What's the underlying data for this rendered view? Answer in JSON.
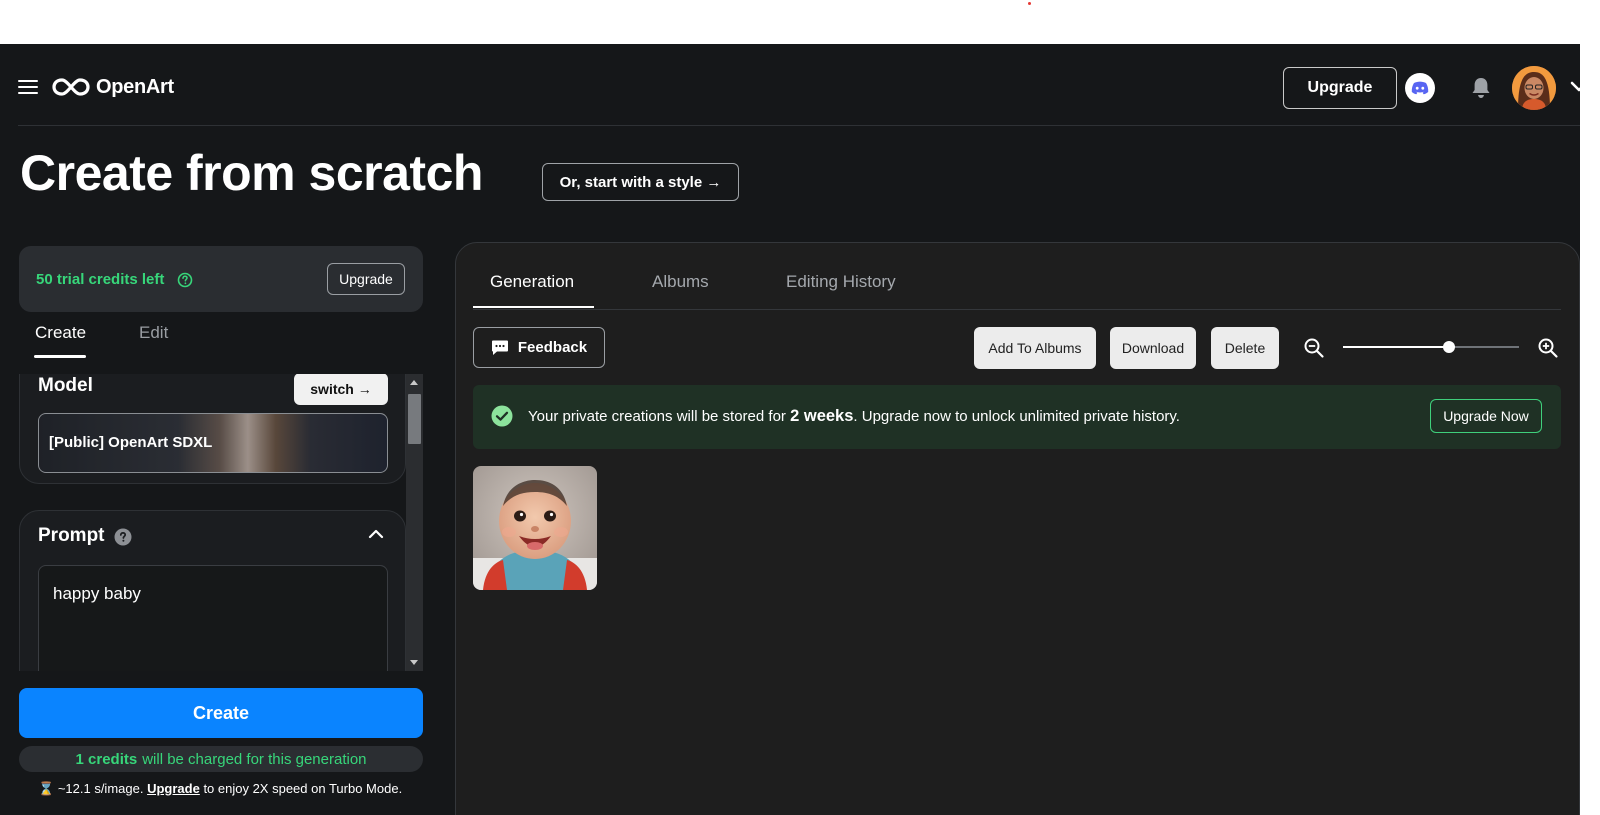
{
  "app": {
    "brand": "OpenArt",
    "upgrade_label": "Upgrade",
    "icons": {
      "menu": "hamburger-menu-icon",
      "logo": "infinity-logo-icon",
      "discord": "discord-icon",
      "notifications": "bell-icon",
      "account_menu": "chevron-down-icon"
    }
  },
  "page": {
    "title": "Create from scratch",
    "style_button": "Or, start with a style →"
  },
  "left": {
    "credits_text": "50 trial credits left",
    "credits_upgrade": "Upgrade",
    "tabs": [
      {
        "label": "Create",
        "active": true
      },
      {
        "label": "Edit",
        "active": false
      }
    ],
    "model": {
      "label": "Model",
      "switch_label": "switch →",
      "selected": "[Public] OpenArt SDXL"
    },
    "prompt": {
      "label": "Prompt",
      "value": "happy baby"
    },
    "create_button": "Create",
    "charge": {
      "amount": "1 credits",
      "suffix": "will be charged for this generation"
    },
    "speed": {
      "icon": "⌛",
      "prefix": "~12.1 s/image.",
      "link": "Upgrade",
      "suffix": "to enjoy 2X speed on Turbo Mode."
    }
  },
  "right": {
    "tabs": [
      {
        "label": "Generation",
        "active": true
      },
      {
        "label": "Albums",
        "active": false
      },
      {
        "label": "Editing History",
        "active": false
      }
    ],
    "toolbar": {
      "feedback": "Feedback",
      "add_to_albums": "Add To Albums",
      "download": "Download",
      "delete": "Delete",
      "zoom_level": 0.6
    },
    "notice": {
      "before": "Your private creations will be stored for",
      "highlight": "2 weeks",
      "after": ". Upgrade now to unlock unlimited private history.",
      "button": "Upgrade Now"
    },
    "images": [
      {
        "subject": "baby-photo"
      }
    ]
  },
  "colors": {
    "background": "#151719",
    "accent_blue": "#0a84ff",
    "credit_green": "#37d67a",
    "notice_bg": "#1f3125"
  }
}
